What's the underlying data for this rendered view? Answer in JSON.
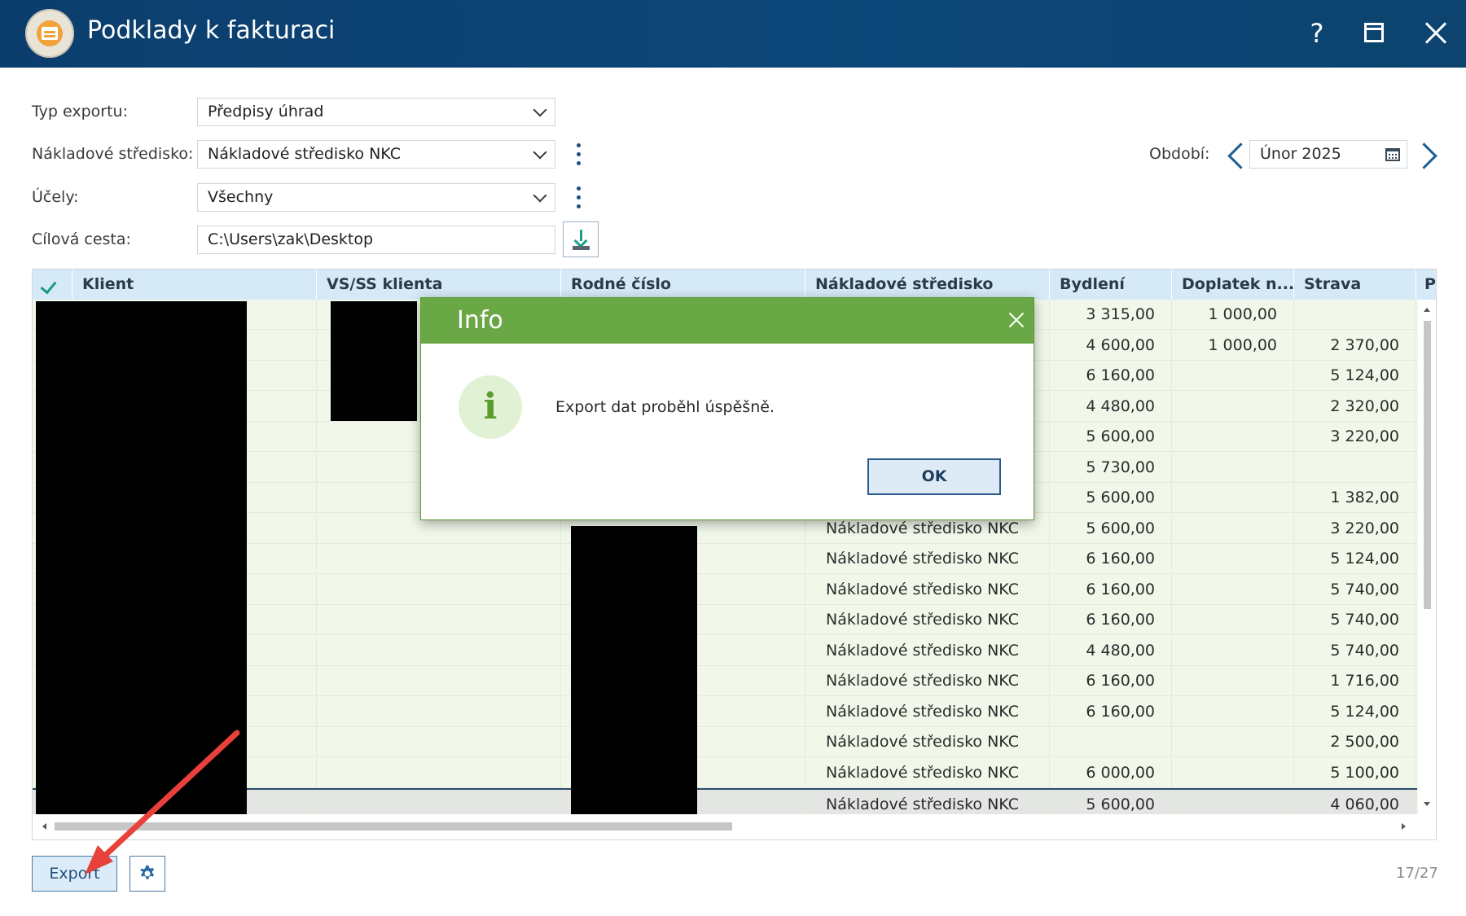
{
  "window": {
    "title": "Podklady k fakturaci",
    "help": "?"
  },
  "form": {
    "export_type": {
      "label": "Typ exportu:",
      "value": "Předpisy úhrad"
    },
    "cost_center": {
      "label": "Nákladové středisko:",
      "value": "Nákladové středisko NKC"
    },
    "purposes": {
      "label": "Účely:",
      "value": "Všechny"
    },
    "target_path": {
      "label": "Cílová cesta:",
      "value": "C:\\Users\\zak\\Desktop"
    },
    "period": {
      "label": "Období:",
      "value": "Únor 2025"
    }
  },
  "grid": {
    "columns": [
      "Klient",
      "VS/SS klienta",
      "Rodné číslo",
      "Nákladové středisko",
      "Bydlení",
      "Doplatek n...",
      "Strava",
      "P"
    ],
    "rows": [
      {
        "ns": "",
        "bydleni": "3 315,00",
        "doplatek": "1 000,00",
        "strava": ""
      },
      {
        "ns": "",
        "bydleni": "4 600,00",
        "doplatek": "1 000,00",
        "strava": "2 370,00"
      },
      {
        "ns": "",
        "bydleni": "6 160,00",
        "doplatek": "",
        "strava": "5 124,00"
      },
      {
        "ns": "",
        "bydleni": "4 480,00",
        "doplatek": "",
        "strava": "2 320,00"
      },
      {
        "ns": "",
        "bydleni": "5 600,00",
        "doplatek": "",
        "strava": "3 220,00"
      },
      {
        "ns": "",
        "bydleni": "5 730,00",
        "doplatek": "",
        "strava": ""
      },
      {
        "ns": "",
        "bydleni": "5 600,00",
        "doplatek": "",
        "strava": "1 382,00"
      },
      {
        "ns": "Nákladové středisko NKC",
        "bydleni": "5 600,00",
        "doplatek": "",
        "strava": "3 220,00"
      },
      {
        "ns": "Nákladové středisko NKC",
        "bydleni": "6 160,00",
        "doplatek": "",
        "strava": "5 124,00"
      },
      {
        "ns": "Nákladové středisko NKC",
        "bydleni": "6 160,00",
        "doplatek": "",
        "strava": "5 740,00"
      },
      {
        "ns": "Nákladové středisko NKC",
        "bydleni": "6 160,00",
        "doplatek": "",
        "strava": "5 740,00"
      },
      {
        "ns": "Nákladové středisko NKC",
        "bydleni": "4 480,00",
        "doplatek": "",
        "strava": "5 740,00"
      },
      {
        "ns": "Nákladové středisko NKC",
        "bydleni": "6 160,00",
        "doplatek": "",
        "strava": "1 716,00"
      },
      {
        "ns": "Nákladové středisko NKC",
        "bydleni": "6 160,00",
        "doplatek": "",
        "strava": "5 124,00"
      },
      {
        "ns": "Nákladové středisko NKC",
        "bydleni": "",
        "doplatek": "",
        "strava": "2 500,00"
      },
      {
        "ns": "Nákladové středisko NKC",
        "bydleni": "6 000,00",
        "doplatek": "",
        "strava": "5 100,00"
      },
      {
        "ns": "Nákladové středisko NKC",
        "bydleni": "5 600,00",
        "doplatek": "",
        "strava": "4 060,00"
      }
    ]
  },
  "footer": {
    "export_label": "Export",
    "counter": "17/27"
  },
  "dialog": {
    "title": "Info",
    "message": "Export dat proběhl úspěšně.",
    "ok_label": "OK",
    "icon_glyph": "i"
  },
  "colors": {
    "titlebar": "#0d4779",
    "dialog_header": "#6aa745",
    "row_bg": "#f1f8ea",
    "header_bg": "#d6e9f7",
    "annotation_arrow": "#e8403a"
  }
}
